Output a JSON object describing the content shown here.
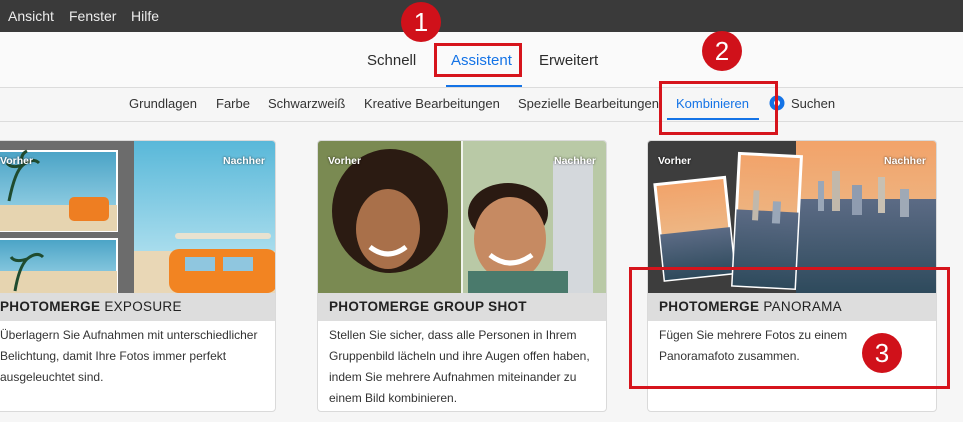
{
  "menu": {
    "items": [
      "Ansicht",
      "Fenster",
      "Hilfe"
    ]
  },
  "modes": {
    "schnell": "Schnell",
    "assistent": "Assistent",
    "erweitert": "Erweitert"
  },
  "subtabs": {
    "grundlagen": "Grundlagen",
    "farbe": "Farbe",
    "schwarzweiss": "Schwarzweiß",
    "kreativ": "Kreative Bearbeitungen",
    "speziell": "Spezielle Bearbeitungen",
    "kombinieren": "Kombinieren",
    "suchen": "Suchen"
  },
  "cards": [
    {
      "before": "Vorher",
      "after": "Nachher",
      "title_bold": "PHOTOMERGE",
      "title_rest": "EXPOSURE",
      "description": "Überlagern Sie Aufnahmen mit unterschiedlicher Belichtung, damit Ihre Fotos immer perfekt ausgeleuchtet sind."
    },
    {
      "before": "Vorher",
      "after": "Nachher",
      "title_bold": "PHOTOMERGE",
      "title_rest": "GROUP SHOT",
      "description": "Stellen Sie sicher, dass alle Personen in Ihrem Gruppenbild lächeln und ihre Augen offen haben, indem Sie mehrere Aufnahmen miteinander zu einem Bild kombinieren."
    },
    {
      "before": "Vorher",
      "after": "Nachher",
      "title_bold": "PHOTOMERGE",
      "title_rest": "PANORAMA",
      "description": "Fügen Sie mehrere Fotos zu einem Panoramafoto zusammen."
    }
  ],
  "callouts": [
    "1",
    "2",
    "3"
  ],
  "colors": {
    "accent": "#1473e6",
    "highlight": "#d6141c",
    "menubar": "#3a3a3a"
  }
}
